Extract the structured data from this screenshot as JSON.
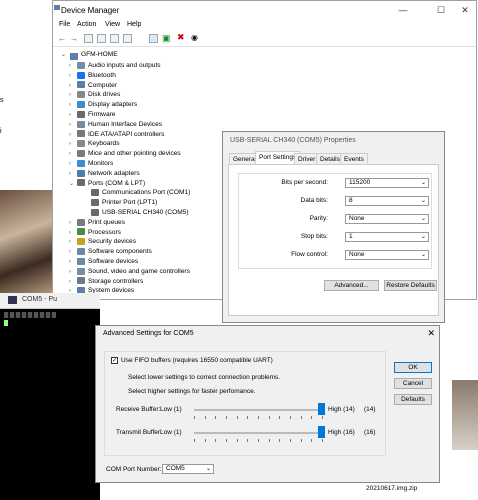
{
  "device_manager": {
    "title": "Device Manager",
    "menu": [
      "File",
      "Action",
      "View",
      "Help"
    ],
    "root": "GFM-HOME",
    "tree": [
      {
        "label": "Audio inputs and outputs",
        "expanded": false,
        "color": "#6e8fb0"
      },
      {
        "label": "Bluetooth",
        "expanded": false,
        "color": "#1a73e8"
      },
      {
        "label": "Computer",
        "expanded": false,
        "color": "#5a7fa8"
      },
      {
        "label": "Disk drives",
        "expanded": false,
        "color": "#888888"
      },
      {
        "label": "Display adapters",
        "expanded": false,
        "color": "#3b8ed0"
      },
      {
        "label": "Firmware",
        "expanded": false,
        "color": "#6a6a6a"
      },
      {
        "label": "Human Interface Devices",
        "expanded": false,
        "color": "#7a8a9a"
      },
      {
        "label": "IDE ATA/ATAPI controllers",
        "expanded": false,
        "color": "#707a80"
      },
      {
        "label": "Keyboards",
        "expanded": false,
        "color": "#8a8a8a"
      },
      {
        "label": "Mice and other pointing devices",
        "expanded": false,
        "color": "#7a7a7a"
      },
      {
        "label": "Monitors",
        "expanded": false,
        "color": "#3b8ed0"
      },
      {
        "label": "Network adapters",
        "expanded": false,
        "color": "#4a7fb0"
      },
      {
        "label": "Ports (COM & LPT)",
        "expanded": true,
        "color": "#6a6a6a"
      },
      {
        "label": "Communications Port (COM1)",
        "child": true,
        "color": "#6a6a6a"
      },
      {
        "label": "Printer Port (LPT1)",
        "child": true,
        "color": "#6a6a6a"
      },
      {
        "label": "USB-SERIAL CH340 (COM5)",
        "child": true,
        "color": "#6a6a6a"
      },
      {
        "label": "Print queues",
        "expanded": false,
        "color": "#7a7a7a"
      },
      {
        "label": "Processors",
        "expanded": false,
        "color": "#4a8a4a"
      },
      {
        "label": "Security devices",
        "expanded": false,
        "color": "#c8a020"
      },
      {
        "label": "Software components",
        "expanded": false,
        "color": "#6a8aa0"
      },
      {
        "label": "Software devices",
        "expanded": false,
        "color": "#6a8aa0"
      },
      {
        "label": "Sound, video and game controllers",
        "expanded": false,
        "color": "#6e8fb0"
      },
      {
        "label": "Storage controllers",
        "expanded": false,
        "color": "#707a80"
      },
      {
        "label": "System devices",
        "expanded": false,
        "color": "#5a7fa8"
      }
    ]
  },
  "properties": {
    "title": "USB-SERIAL CH340 (COM5) Properties",
    "tabs": [
      "General",
      "Port Settings",
      "Driver",
      "Details",
      "Events"
    ],
    "active_tab": "Port Settings",
    "fields": [
      {
        "label": "Bits per second:",
        "value": "115200"
      },
      {
        "label": "Data bits:",
        "value": "8"
      },
      {
        "label": "Parity:",
        "value": "None"
      },
      {
        "label": "Stop bits:",
        "value": "1"
      },
      {
        "label": "Flow control:",
        "value": "None"
      }
    ],
    "advanced_label": "Advanced...",
    "restore_label": "Restore Defaults"
  },
  "putty": {
    "title": "COM5 - Pu"
  },
  "advanced": {
    "title": "Advanced Settings for COM5",
    "use_fifo_label": "Use FIFO buffers (requires 16550 compatible UART)",
    "use_fifo_checked": true,
    "hint1": "Select lower settings to correct connection problems.",
    "hint2": "Select higher settings for faster perfomance.",
    "receive": {
      "label": "Receive Buffer:",
      "low": "Low (1)",
      "high": "High (14)",
      "current": "(14)",
      "level": 1.0
    },
    "transmit": {
      "label": "Transmit Buffer:",
      "low": "Low (1)",
      "high": "High (16)",
      "current": "(16)",
      "level": 1.0
    },
    "com_port_label": "COM Port Number:",
    "com_port_value": "COM5",
    "ok_label": "OK",
    "cancel_label": "Cancel",
    "defaults_label": "Defaults"
  },
  "background": {
    "side_text_a": "s",
    "side_text_b": "i",
    "file_label": "20210617.img.zip"
  }
}
